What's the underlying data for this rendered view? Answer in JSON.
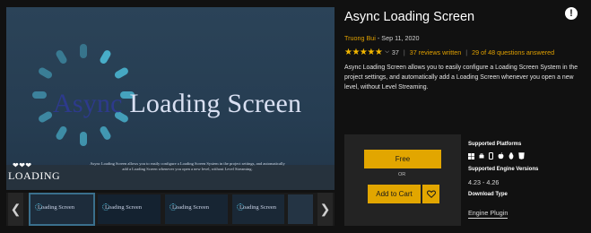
{
  "product": {
    "title": "Async Loading Screen",
    "author": "Truong Bui",
    "date_sep": " - ",
    "date": "Sep 11, 2020",
    "rating_stars": "★★★★★",
    "rating_value": 4.5,
    "rating_count": "37",
    "reviews_link": "37 reviews written",
    "questions_link": "29 of 48 questions answered",
    "description": "Async Loading Screen allows you to easily configure a Loading Screen System in the project settings, and automatically add a Loading Screen whenever you open a new level, without Level Streaming."
  },
  "media": {
    "title_async": "Async",
    "title_rest": " Loading Screen",
    "hearts": "❤❤❤",
    "logo_text": "LOADING",
    "caption": "Async Loading Screen allows you to easily configure a Loading Screen System in the project settings, and automatically add a Loading Screen whenever you open a new level, without Level Streaming.",
    "thumbnails": [
      {
        "label": "Loading Screen"
      },
      {
        "label": "Loading Screen"
      },
      {
        "label": "Loading Screen"
      },
      {
        "label": "Loading Screen"
      },
      {
        "label": ""
      }
    ]
  },
  "purchase": {
    "free_label": "Free",
    "or_label": "OR",
    "add_to_cart_label": "Add to Cart"
  },
  "specs": {
    "platforms_heading": "Supported Platforms",
    "platforms": [
      "windows-icon",
      "android-icon",
      "apple-icon",
      "linux-icon",
      "html5-icon"
    ],
    "engine_heading": "Supported Engine Versions",
    "engine_versions": "4.23 - 4.26",
    "download_heading": "Download Type",
    "download_type": "Engine Plugin"
  },
  "colors": {
    "accent": "#e2a600",
    "link": "#e0a000",
    "background": "#111111",
    "panel": "#232323"
  }
}
